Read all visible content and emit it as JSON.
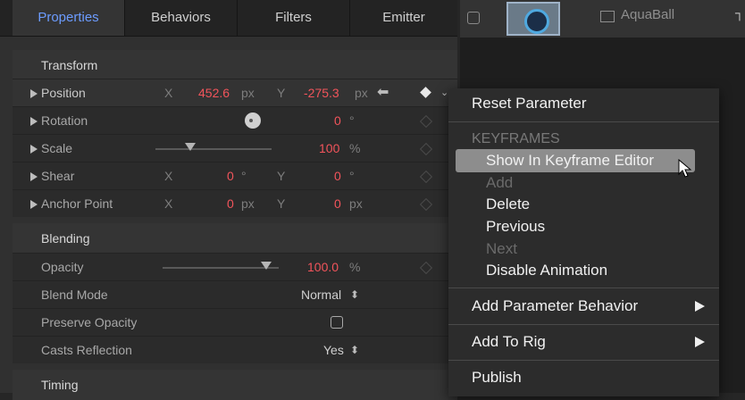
{
  "tabs": [
    "Properties",
    "Behaviors",
    "Filters",
    "Emitter"
  ],
  "layer": {
    "name": "AquaBall"
  },
  "transform": {
    "header": "Transform",
    "position": {
      "label": "Position",
      "x_label": "X",
      "x_value": "452.6",
      "x_unit": "px",
      "y_label": "Y",
      "y_value": "-275.3",
      "y_unit": "px"
    },
    "rotation": {
      "label": "Rotation",
      "value": "0",
      "unit": "°"
    },
    "scale": {
      "label": "Scale",
      "value": "100",
      "unit": "%"
    },
    "shear": {
      "label": "Shear",
      "x_label": "X",
      "x_value": "0",
      "x_unit": "°",
      "y_label": "Y",
      "y_value": "0",
      "y_unit": "°"
    },
    "anchor": {
      "label": "Anchor Point",
      "x_label": "X",
      "x_value": "0",
      "x_unit": "px",
      "y_label": "Y",
      "y_value": "0",
      "y_unit": "px"
    }
  },
  "blending": {
    "header": "Blending",
    "opacity": {
      "label": "Opacity",
      "value": "100.0",
      "unit": "%"
    },
    "blend_mode": {
      "label": "Blend Mode",
      "value": "Normal"
    },
    "preserve_opacity": {
      "label": "Preserve Opacity",
      "checked": false
    },
    "casts_reflection": {
      "label": "Casts Reflection",
      "value": "Yes"
    }
  },
  "timing": {
    "header": "Timing"
  },
  "context_menu": {
    "reset": "Reset Parameter",
    "keyframes_header": "KEYFRAMES",
    "show_in_editor": "Show In Keyframe Editor",
    "add": "Add",
    "delete": "Delete",
    "previous": "Previous",
    "next": "Next",
    "disable_animation": "Disable Animation",
    "add_behavior": "Add Parameter Behavior",
    "add_to_rig": "Add To Rig",
    "publish": "Publish"
  },
  "colors": {
    "accent_tab": "#6c9cff",
    "value_red": "#f2545b",
    "menu_bg": "#2c2c2c",
    "menu_highlight": "#8a8a8a"
  }
}
